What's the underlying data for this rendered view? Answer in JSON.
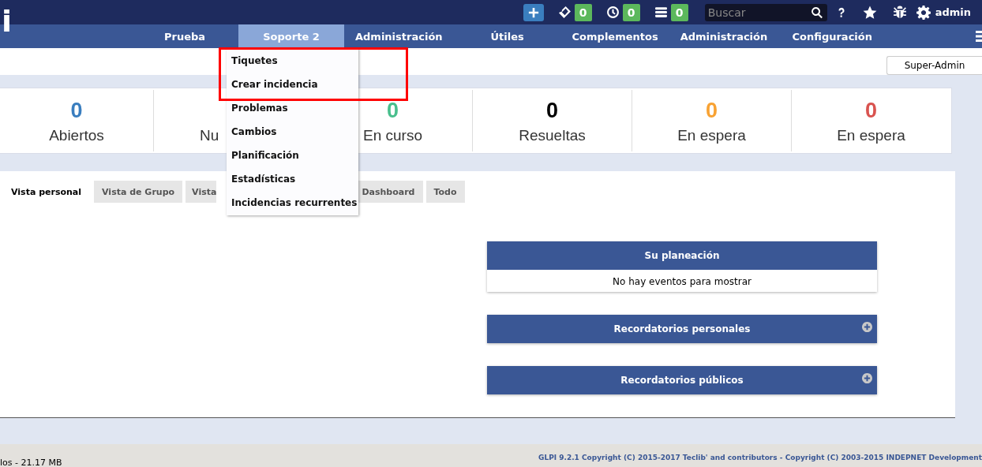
{
  "logo": "i",
  "topbar": {
    "counters": [
      {
        "kind": "ticket",
        "count": "0"
      },
      {
        "kind": "clock",
        "count": "0"
      },
      {
        "kind": "list",
        "count": "0"
      }
    ],
    "search": {
      "placeholder": "Buscar"
    },
    "user": "admin"
  },
  "nav": [
    {
      "label": "Prueba",
      "selected": false
    },
    {
      "label": "Soporte 2",
      "selected": true
    },
    {
      "label": "Administración",
      "selected": false
    },
    {
      "label": "Útiles",
      "selected": false
    },
    {
      "label": "Complementos",
      "selected": false
    },
    {
      "label": "Administración",
      "selected": false
    },
    {
      "label": "Configuración",
      "selected": false
    }
  ],
  "dropdown": [
    "Tiquetes",
    "Crear incidencia",
    "Problemas",
    "Cambios",
    "Planificación",
    "Estadísticas",
    "Incidencias recurrentes"
  ],
  "profile": "Super-Admin",
  "stats": [
    {
      "count": "0",
      "label": "Abiertos",
      "color": "#3a7ebf"
    },
    {
      "label": "Nu"
    },
    {
      "count": "0",
      "label": "En curso",
      "color": "#49bf8d"
    },
    {
      "count": "0",
      "label": "Resueltas",
      "color": "#000000"
    },
    {
      "count": "0",
      "label": "En espera",
      "color": "#f8a233"
    },
    {
      "count": "0",
      "label": "En espera",
      "color": "#d9534f"
    }
  ],
  "tabs": [
    {
      "label": "Vista personal",
      "selected": true
    },
    {
      "label": "Vista de Grupo",
      "selected": false
    },
    {
      "label": "Vista",
      "selected": false
    },
    {
      "label": "Dashboard",
      "selected": false
    },
    {
      "label": "Todo",
      "selected": false
    }
  ],
  "panels": [
    {
      "title": "Su planeación",
      "expanded": true,
      "body": "No hay eventos para mostrar"
    },
    {
      "title": "Recordatorios personales",
      "expanded": false
    },
    {
      "title": "Recordatorios públicos",
      "expanded": false
    }
  ],
  "footer": {
    "left": "los - 21.17 MB",
    "right": "GLPI 9.2.1 Copyright (C) 2015-2017 Teclib' and contributors - Copyright (C) 2003-2015 INDEPNET Development"
  }
}
